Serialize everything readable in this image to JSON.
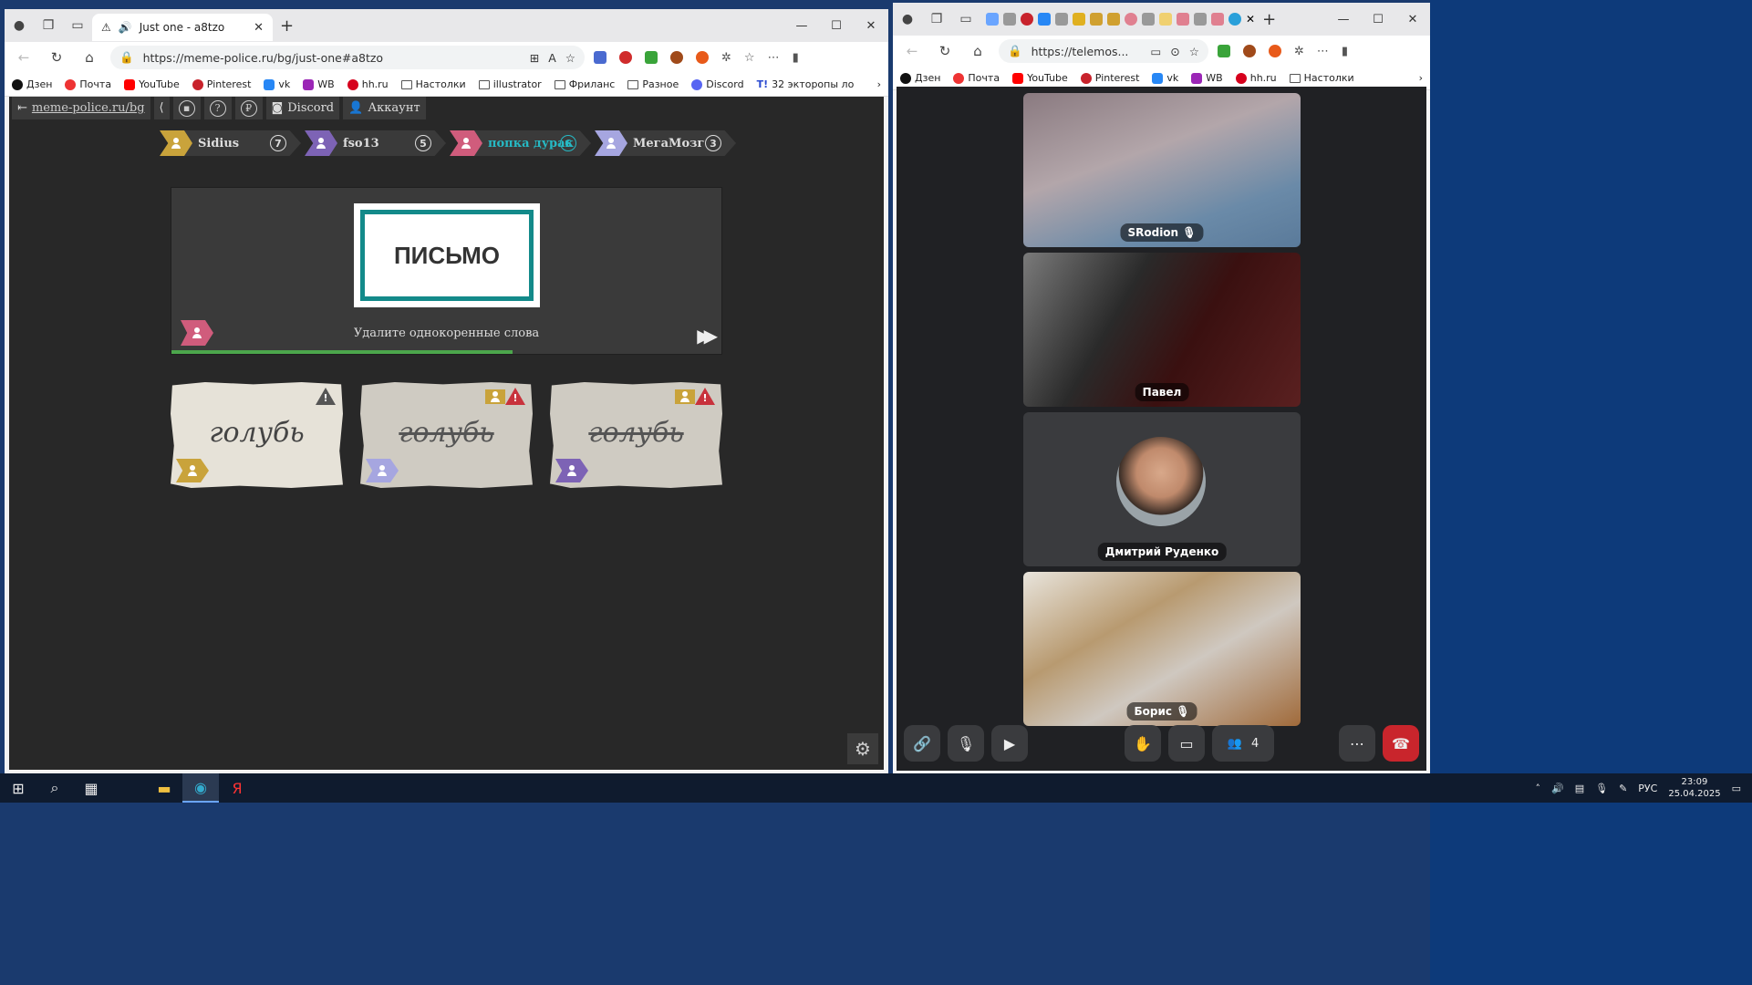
{
  "left_browser": {
    "tab_title": "Just one - a8tzo",
    "url": "https://meme-police.ru/bg/just-one#a8tzo",
    "bookmarks": [
      "Дзен",
      "Почта",
      "YouTube",
      "Pinterest",
      "vk",
      "WB",
      "hh.ru",
      "Настолки",
      "illustrator",
      "Фриланс",
      "Разное",
      "Discord",
      "32 экторопы ло"
    ]
  },
  "site": {
    "home_link": "meme-police.ru/bg",
    "discord": "Discord",
    "account": "Аккаунт"
  },
  "players": [
    {
      "name": "Sidius",
      "score": "7",
      "color": "#c9a33b",
      "active": false
    },
    {
      "name": "fso13",
      "score": "5",
      "color": "#7d63b5",
      "active": false
    },
    {
      "name": "попка дурак",
      "score": "6",
      "color": "#d05c7c",
      "active": true
    },
    {
      "name": "МегаМозг",
      "score": "3",
      "color": "#a6a6e0",
      "active": false
    }
  ],
  "board": {
    "secret_word": "ПИСЬМО",
    "hint": "Удалите однокоренные слова",
    "progress": 0.62
  },
  "clues": [
    {
      "word": "голубь",
      "struck": false,
      "player_color": "#c9a33b",
      "warn_color": "#555555",
      "same_icon": false
    },
    {
      "word": "голубь",
      "struck": true,
      "player_color": "#a6a6e0",
      "warn_color": "#c8323c",
      "same_icon": true
    },
    {
      "word": "голубь",
      "struck": true,
      "player_color": "#7d63b5",
      "warn_color": "#c8323c",
      "same_icon": true
    }
  ],
  "right_browser": {
    "url": "https://telemos...",
    "bookmarks": [
      "Дзен",
      "Почта",
      "YouTube",
      "Pinterest",
      "vk",
      "WB",
      "hh.ru",
      "Настолки"
    ]
  },
  "call": {
    "participants": [
      "SRodion",
      "Павел",
      "Дмитрий Руденко",
      "Борис"
    ],
    "count": "4"
  },
  "taskbar": {
    "lang": "РУС",
    "time": "23:09",
    "date": "25.04.2025"
  }
}
